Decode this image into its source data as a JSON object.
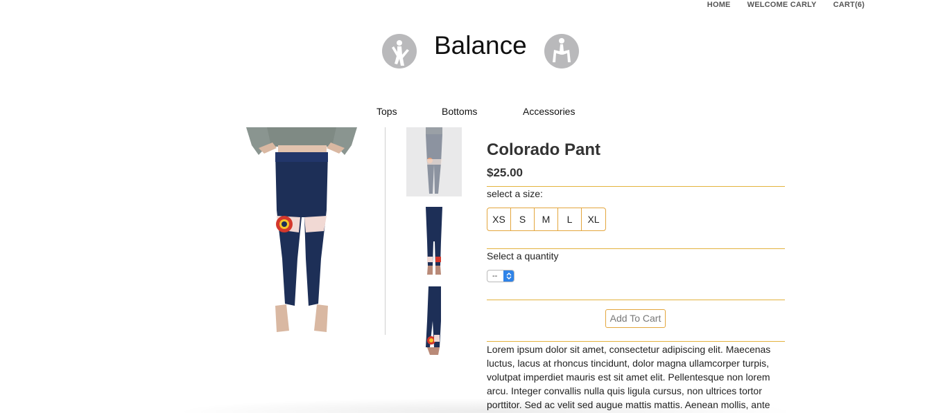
{
  "topnav": {
    "home": "HOME",
    "welcome": "WELCOME CARLY",
    "cart": "CART(6)"
  },
  "brand": {
    "title": "Balance",
    "left_icon": "yoga-pose-icon",
    "right_icon": "yoga-pose-icon",
    "icon_color": "#b9b9bb"
  },
  "categories": [
    "Tops",
    "Bottoms",
    "Accessories"
  ],
  "product": {
    "name": "Colorado Pant",
    "price": "$25.00",
    "size_label": "select a size:",
    "sizes": [
      "XS",
      "S",
      "M",
      "L",
      "XL"
    ],
    "quantity_label": "Select a quantity",
    "quantity_value": "--",
    "add_to_cart": "Add To Cart",
    "description": "Lorem ipsum dolor sit amet, consectetur adipiscing elit. Maecenas luctus, lacus at rhoncus tincidunt, dolor magna ullamcorper turpis, volutpat imperdiet mauris est sit amet elit. Pellentesque non lorem arcu. Integer convallis nulla quis ligula cursus, non ultrices tortor porttitor. Sed ac velit sed augue mattis mattis. Aenean mollis, ante"
  },
  "colors": {
    "accent": "#e3a53c",
    "legging_navy": "#1d2f57",
    "select_blue": "#2f83e8"
  }
}
